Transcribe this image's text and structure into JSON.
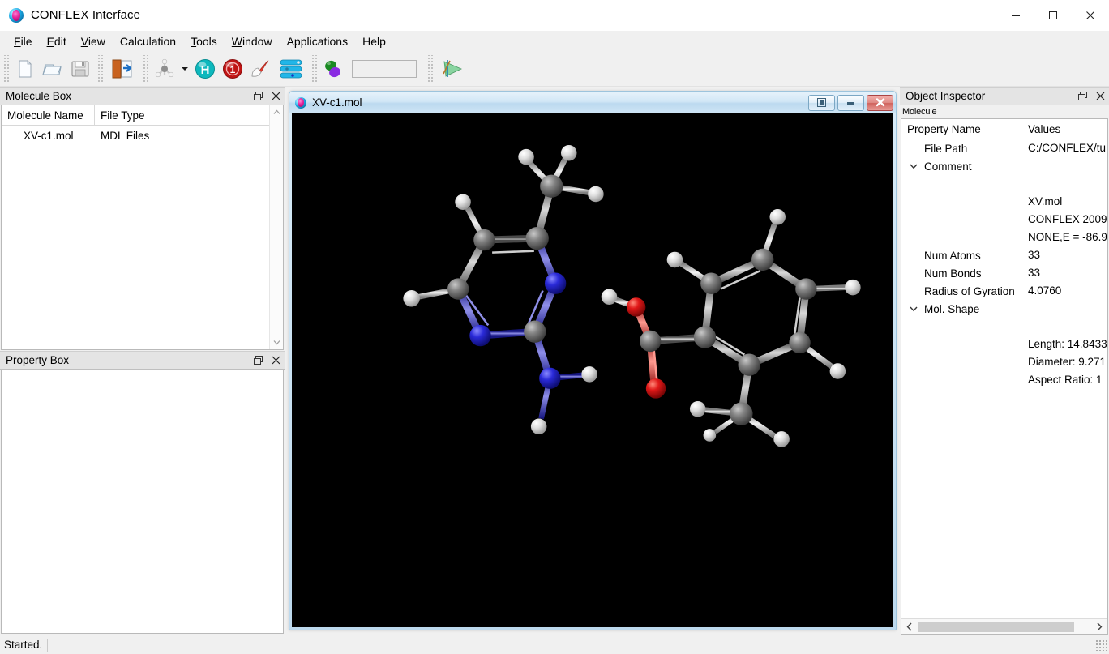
{
  "window": {
    "title": "CONFLEX Interface",
    "app_icon": "conflex-logo-icon",
    "minimize_label": "Minimize",
    "maximize_label": "Maximize",
    "close_label": "Close"
  },
  "menubar": {
    "items": [
      {
        "label": "File",
        "mnemonic": "F"
      },
      {
        "label": "Edit",
        "mnemonic": "E"
      },
      {
        "label": "View",
        "mnemonic": "V"
      },
      {
        "label": "Calculation",
        "mnemonic": "C"
      },
      {
        "label": "Tools",
        "mnemonic": "T"
      },
      {
        "label": "Window",
        "mnemonic": "W"
      },
      {
        "label": "Applications",
        "mnemonic": "A"
      },
      {
        "label": "Help",
        "mnemonic": "H"
      }
    ]
  },
  "toolbar": {
    "groups": [
      {
        "buttons": [
          {
            "name": "new-file-icon",
            "label": "New"
          },
          {
            "name": "open-folder-icon",
            "label": "Open"
          },
          {
            "name": "save-floppy-icon",
            "label": "Save"
          }
        ]
      },
      {
        "buttons": [
          {
            "name": "import-export-icon",
            "label": "Import"
          }
        ]
      },
      {
        "buttons": [
          {
            "name": "molecule-model-icon",
            "label": "Molecule Display"
          },
          {
            "name": "chevron-down-icon",
            "label": "Display Options"
          },
          {
            "name": "hydrogen-atom-icon",
            "label": "Show Hydrogens"
          },
          {
            "name": "atom-number-icon",
            "label": "Atom Numbers"
          },
          {
            "name": "pen-select-icon",
            "label": "Edit Structure"
          },
          {
            "name": "layers-icon",
            "label": "Layers"
          }
        ]
      },
      {
        "buttons": [
          {
            "name": "orbital-icon",
            "label": "Orbitals"
          }
        ],
        "combo": {
          "name": "orbital-combo",
          "value": "",
          "placeholder": ""
        }
      },
      {
        "buttons": [
          {
            "name": "axes-tripod-icon",
            "label": "Coordinate Axes"
          }
        ]
      }
    ]
  },
  "molecule_box": {
    "title": "Molecule Box",
    "float_label": "Float",
    "close_label": "Close",
    "columns": [
      "Molecule Name",
      "File Type"
    ],
    "rows": [
      {
        "name": "XV-c1.mol",
        "type": "MDL Files"
      }
    ]
  },
  "property_box": {
    "title": "Property Box",
    "float_label": "Float",
    "close_label": "Close",
    "content": ""
  },
  "mdi": {
    "title": "XV-c1.mol",
    "icon": "conflex-logo-icon",
    "restore_label": "Restore",
    "minimize_label": "Minimize",
    "close_label": "Close",
    "background": "#000000"
  },
  "object_inspector": {
    "title": "Object Inspector",
    "float_label": "Float",
    "close_label": "Close",
    "subtitle": "Molecule",
    "columns": [
      "Property Name",
      "Values"
    ],
    "rows": [
      {
        "caret": "",
        "name": "File Path",
        "value": "C:/CONFLEX/tu"
      },
      {
        "caret": "v",
        "name": "Comment",
        "value": ""
      },
      {
        "caret": "",
        "name": "",
        "value": ""
      },
      {
        "caret": "",
        "name": "",
        "value": "XV.mol"
      },
      {
        "caret": "",
        "name": "",
        "value": "CONFLEX 2009"
      },
      {
        "caret": "",
        "name": "",
        "value": "NONE,E = -86.9"
      },
      {
        "caret": "",
        "name": "Num Atoms",
        "value": "33"
      },
      {
        "caret": "",
        "name": "Num Bonds",
        "value": "33"
      },
      {
        "caret": "",
        "name": "Radius of Gyration",
        "value": "4.0760"
      },
      {
        "caret": "v",
        "name": "Mol. Shape",
        "value": ""
      },
      {
        "caret": "",
        "name": "",
        "value": ""
      },
      {
        "caret": "",
        "name": "",
        "value": "Length: 14.8433"
      },
      {
        "caret": "",
        "name": "",
        "value": "Diameter: 9.271"
      },
      {
        "caret": "",
        "name": "",
        "value": "Aspect Ratio: 1"
      }
    ],
    "hscroll": {
      "left_label": "Scroll left",
      "right_label": "Scroll right"
    }
  },
  "statusbar": {
    "message": "Started."
  },
  "colors": {
    "carbon": "#6e6e6e",
    "nitrogen": "#2222cc",
    "oxygen": "#d81010",
    "hydrogen": "#e8e8e8",
    "viewport_bg": "#000000",
    "title_accent": "#1aa6e0"
  },
  "molecule_view": {
    "description": "ball-and-stick 3D model of two molecules on black background",
    "molecules": [
      "2-amino-4-methylpyrimidine",
      "2-methylbenzoic acid"
    ]
  }
}
